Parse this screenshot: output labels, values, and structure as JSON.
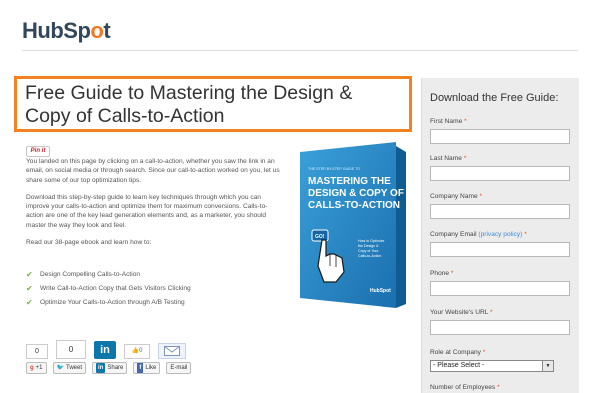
{
  "logo": {
    "part1": "HubSp",
    "part2": "o",
    "part3": "t"
  },
  "title": "Free Guide to Mastering the Design & Copy of Calls-to-Action",
  "pinit_label": "Pin it",
  "intro": [
    "You landed on this page by clicking on a call-to-action, whether you saw the link in an email, on social media or through search. Since our call-to-action worked on you, let us share some of our top optimization tips.",
    "Download this step-by-step guide to learn key techniques through which you can improve your calls-to-action and optimize them for maximum conversions. Calls-to-action are one of the key lead generation elements and, as a marketer, you should master the way they look and feel.",
    "Read our 38-page ebook and learn how to:"
  ],
  "bullets": [
    "Design Compelling Calls-to-Action",
    "Write Call-to-Action Copy that Gets Visitors Clicking",
    "Optimize Your Calls-to-Action through A/B Testing"
  ],
  "book": {
    "kicker": "THE STEP-BY-STEP GUIDE TO",
    "title_lines": [
      "MASTERING THE",
      "DESIGN & COPY OF",
      "CALLS-TO-ACTION"
    ],
    "go": "GO!",
    "side_text": [
      "How to Optimize",
      "the Design &",
      "Copy of Your",
      "Calls-to-Action"
    ],
    "brand": "HubSpot"
  },
  "social": {
    "count_a": "0",
    "count_b": "0",
    "linkedin_big": "in",
    "fb_count": "0",
    "gplus": "+1",
    "tweet": "Tweet",
    "share": "Share",
    "like": "Like",
    "email": "E-mail",
    "in_small": "in",
    "fb_small": "f"
  },
  "form": {
    "heading": "Download the Free Guide:",
    "required_mark": "*",
    "fields": {
      "first_name": "First Name",
      "last_name": "Last Name",
      "company_name": "Company Name",
      "company_email": "Company Email",
      "privacy": "(privacy policy)",
      "phone": "Phone",
      "website": "Your Website's URL",
      "role": "Role at Company",
      "role_value": "- Please Select -",
      "employees": "Number of Employees"
    }
  }
}
